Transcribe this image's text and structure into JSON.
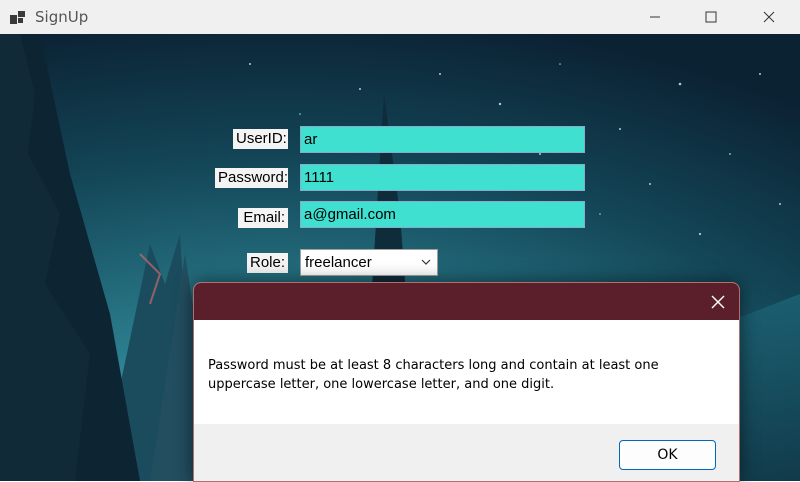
{
  "window": {
    "title": "SignUp",
    "icon": "app-window-icon"
  },
  "form": {
    "userid_label": "UserID:",
    "userid_value": "ar",
    "password_label": "Password:",
    "password_value": "1111",
    "email_label": "Email:",
    "email_value": "a@gmail.com",
    "role_label": "Role:",
    "role_value": "freelancer"
  },
  "dialog": {
    "message": "Password must be at least 8 characters long and contain at least one uppercase letter, one lowercase letter, and one digit.",
    "ok_label": "OK"
  },
  "colors": {
    "input_bg": "#40e0d0",
    "dialog_titlebar": "#5a1f2a",
    "ok_border": "#0067c0"
  }
}
